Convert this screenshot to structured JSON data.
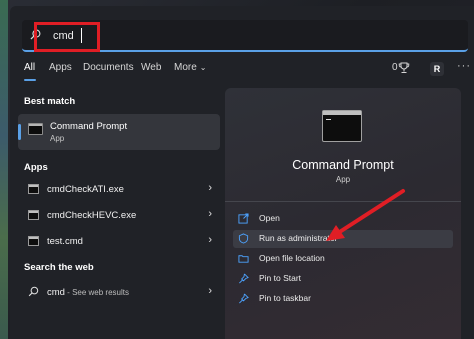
{
  "search": {
    "value": "cmd"
  },
  "tabs": [
    {
      "label": "All",
      "active": true
    },
    {
      "label": "Apps",
      "active": false
    },
    {
      "label": "Documents",
      "active": false
    },
    {
      "label": "Web",
      "active": false
    },
    {
      "label": "More",
      "active": false
    }
  ],
  "header_right": {
    "points": "0",
    "avatar": "R"
  },
  "left": {
    "best_match_title": "Best match",
    "best_match": {
      "name": "Command Prompt",
      "type": "App"
    },
    "apps_title": "Apps",
    "apps": [
      {
        "name": "cmdCheckATI.exe"
      },
      {
        "name": "cmdCheckHEVC.exe"
      },
      {
        "name": "test.cmd"
      }
    ],
    "web_title": "Search the web",
    "web_result": {
      "query": "cmd",
      "suffix": " - See web results"
    }
  },
  "detail": {
    "title": "Command Prompt",
    "subtitle": "App",
    "actions": [
      {
        "label": "Open",
        "icon": "open-icon"
      },
      {
        "label": "Run as administrator",
        "icon": "shield-icon"
      },
      {
        "label": "Open file location",
        "icon": "folder-icon"
      },
      {
        "label": "Pin to Start",
        "icon": "pin-icon"
      },
      {
        "label": "Pin to taskbar",
        "icon": "pin-icon"
      }
    ]
  },
  "colors": {
    "accent": "#5aa0e6",
    "annotation_red": "#e01e25"
  }
}
